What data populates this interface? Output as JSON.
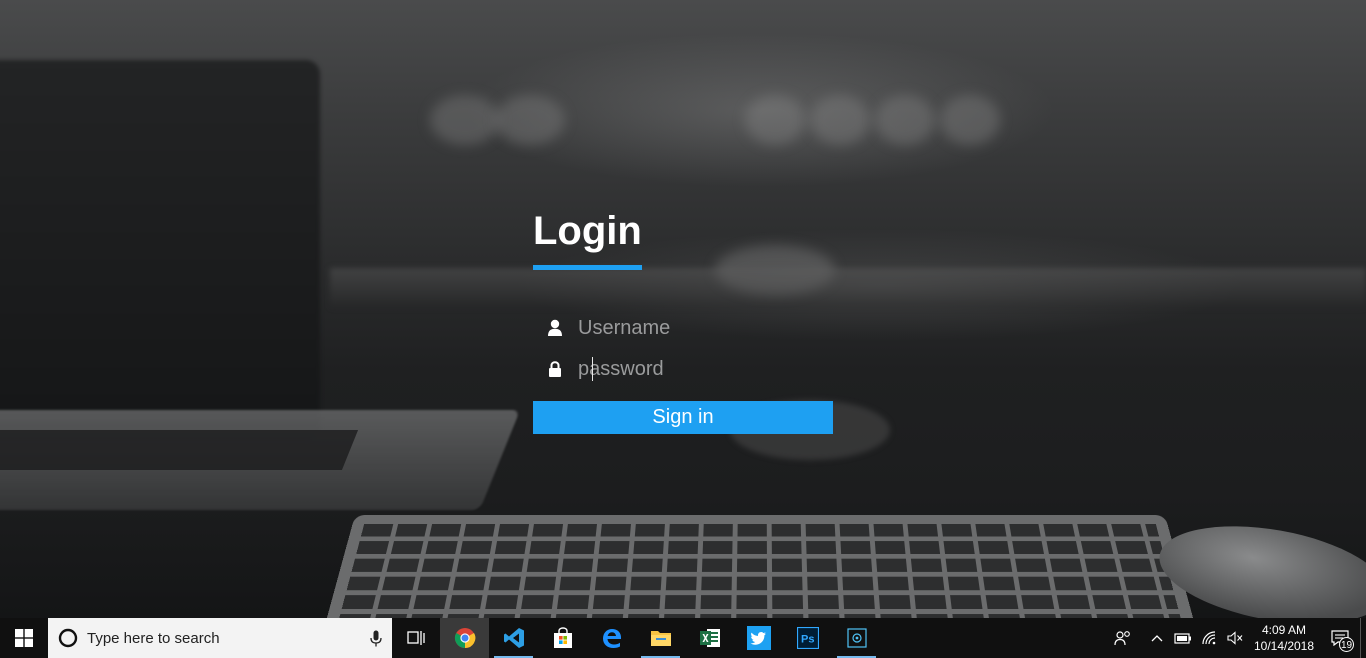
{
  "login": {
    "title": "Login",
    "username_placeholder": "Username",
    "password_placeholder": "password",
    "signin_label": "Sign in",
    "accent_color": "#1ea0f2"
  },
  "taskbar": {
    "search_placeholder": "Type here to search",
    "apps": [
      {
        "icon": "chrome-icon",
        "state": "active"
      },
      {
        "icon": "vscode-icon",
        "state": "running"
      },
      {
        "icon": "store-icon",
        "state": "pinned"
      },
      {
        "icon": "edge-icon",
        "state": "pinned"
      },
      {
        "icon": "file-explorer-icon",
        "state": "running"
      },
      {
        "icon": "excel-icon",
        "state": "pinned"
      },
      {
        "icon": "twitter-icon",
        "state": "pinned"
      },
      {
        "icon": "photoshop-icon",
        "state": "pinned"
      },
      {
        "icon": "app-icon",
        "state": "running"
      }
    ],
    "tray": {
      "time": "4:09 AM",
      "date": "10/14/2018",
      "notification_count": "19"
    }
  }
}
